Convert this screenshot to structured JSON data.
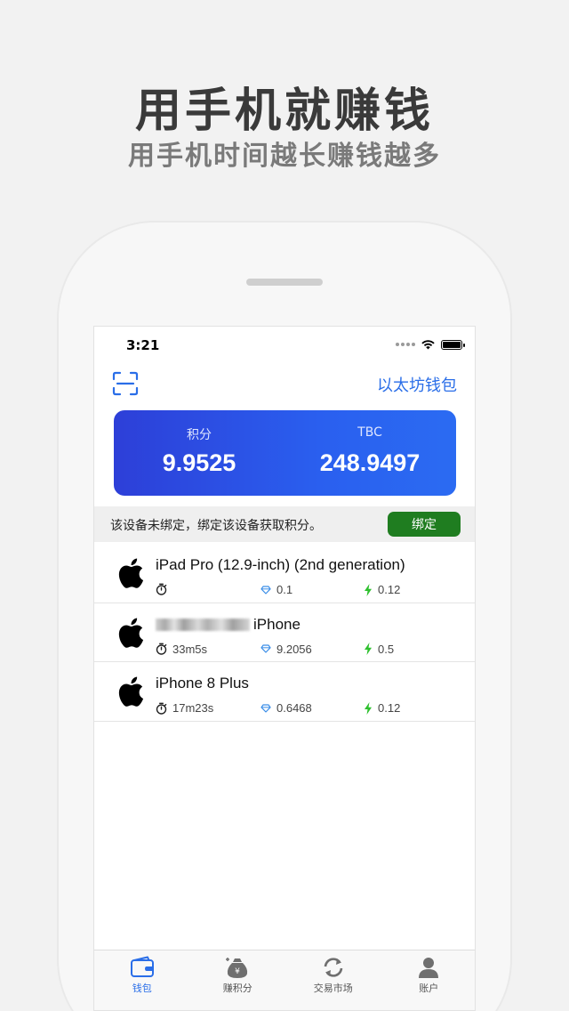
{
  "promo": {
    "title": "用手机就赚钱",
    "subtitle": "用手机时间越长赚钱越多"
  },
  "status_bar": {
    "time": "3:21"
  },
  "header": {
    "scan_icon": "scan-icon",
    "wallet_link": "以太坊钱包"
  },
  "balance": {
    "points_label": "积分",
    "points_value": "9.9525",
    "tbc_label": "TBC",
    "tbc_value": "248.9497"
  },
  "notice": {
    "text": "该设备未绑定，绑定该设备获取积分。",
    "bind_label": "绑定"
  },
  "devices": [
    {
      "name": "iPad Pro (12.9-inch) (2nd generation)",
      "time": "",
      "points": "0.1",
      "energy": "0.12"
    },
    {
      "name": "iPhone",
      "time": "33m5s",
      "points": "9.2056",
      "energy": "0.5"
    },
    {
      "name": "iPhone 8 Plus",
      "time": "17m23s",
      "points": "0.6468",
      "energy": "0.12"
    }
  ],
  "tabs": [
    {
      "label": "钱包",
      "icon": "wallet-icon",
      "active": true
    },
    {
      "label": "赚积分",
      "icon": "money-bag-icon",
      "active": false
    },
    {
      "label": "交易市场",
      "icon": "exchange-icon",
      "active": false
    },
    {
      "label": "账户",
      "icon": "person-icon",
      "active": false
    }
  ],
  "colors": {
    "accent": "#2a6ee8",
    "card_gradient_start": "#2d3fd8",
    "card_gradient_end": "#2b6bf2",
    "bind_button": "#1f7d20",
    "energy": "#2ec02e"
  }
}
